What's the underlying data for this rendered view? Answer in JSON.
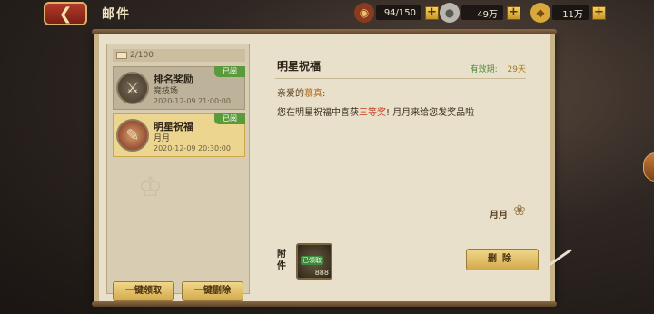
{
  "header": {
    "title": "邮件",
    "back_icon": "back-arrow-icon"
  },
  "resources": [
    {
      "icon": "stamina-drum-icon",
      "value": "94/150"
    },
    {
      "icon": "silver-coin-icon",
      "value": "49万"
    },
    {
      "icon": "gold-ingot-icon",
      "value": "11万"
    }
  ],
  "mail_list": {
    "count": "2/100",
    "items": [
      {
        "title": "排名奖励",
        "subtitle": "竞技场",
        "time": "2020-12-09 21:00:00",
        "badge": "已阅",
        "icon": "crossed-swords-icon"
      },
      {
        "title": "明星祝福",
        "subtitle": "月月",
        "time": "2020-12-09 20:30:00",
        "badge": "已阅",
        "icon": "scroll-icon"
      }
    ],
    "claim_all_label": "一键领取",
    "delete_all_label": "一键删除"
  },
  "detail": {
    "title": "明星祝福",
    "validity_label": "有效期:",
    "validity_value": "29天",
    "greeting_prefix": "亲爱的",
    "recipient": "慕真",
    "greeting_suffix": ":",
    "body_part1": "您在明星祝福中喜获",
    "body_prize": "三等奖",
    "body_part2": "! 月月来给您发奖品啦",
    "signature": "月月",
    "attachment_label": "附件",
    "attachment": {
      "icon": "treasure-bag-icon",
      "tag": "已领取",
      "quantity": "888"
    },
    "delete_label": "删除"
  }
}
